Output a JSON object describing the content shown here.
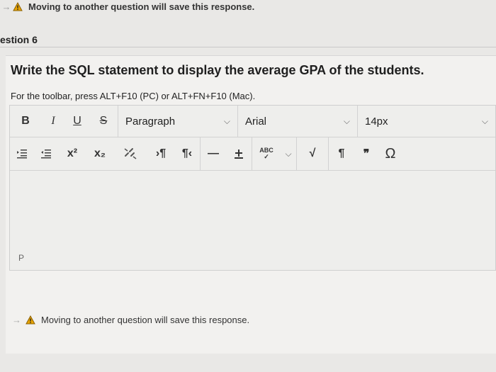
{
  "warning": {
    "text": "Moving to another question will save this response."
  },
  "question": {
    "label": "estion 6",
    "text": "Write the SQL statement to display the average GPA of the students.",
    "hint": "For the toolbar, press ALT+F10 (PC) or ALT+FN+F10 (Mac)."
  },
  "editor": {
    "format": {
      "bold": "B",
      "italic": "I",
      "underline": "U",
      "strike": "S"
    },
    "paragraph": "Paragraph",
    "font": "Arial",
    "size": "14px",
    "row2": {
      "sup": "x²",
      "sub": "x₂",
      "spell": "ABC",
      "pilcrow": "¶",
      "quote": "❞",
      "omega": "Ω"
    },
    "path": "P"
  },
  "colors": {
    "warning_fill": "#e8a400",
    "background": "#e9e8e6"
  }
}
